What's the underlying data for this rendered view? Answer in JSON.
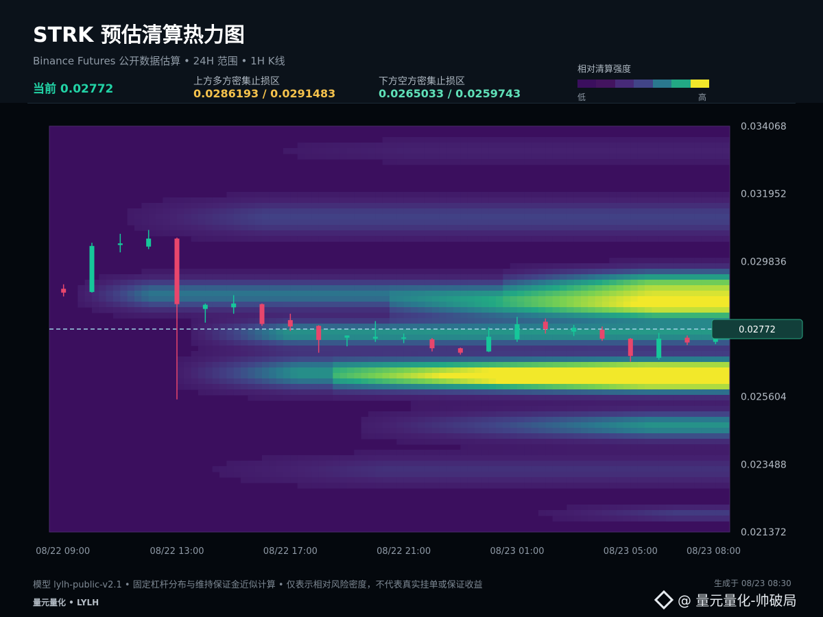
{
  "header": {
    "title": "STRK 预估清算热力图",
    "subtitle": "Binance Futures 公开数据估算 • 24H 范围 • 1H K线",
    "current_price_text": "当前 0.02772",
    "upper_zone_label": "上方多方密集止损区",
    "upper_zone_value": "0.0286193 / 0.0291483",
    "lower_zone_label": "下方空方密集止损区",
    "lower_zone_value": "0.0265033 / 0.0259743"
  },
  "legend": {
    "title": "相对清算强度",
    "low": "低",
    "high": "高",
    "colors": [
      "#3b0f5e",
      "#43145f",
      "#472a78",
      "#414487",
      "#2a788e",
      "#22a884",
      "#f2e82a"
    ]
  },
  "chart_data": {
    "type": "heatmap",
    "overlay": "candlestick",
    "y_ticks": [
      "0.034068",
      "0.031952",
      "0.029836",
      "0.027720",
      "0.025604",
      "0.023488",
      "0.021372"
    ],
    "y_tick_labels": [
      "0.034068",
      "0.031952",
      "0.029836",
      "",
      "0.025604",
      "0.023488",
      "0.021372"
    ],
    "ylim": [
      0.021372,
      0.034068
    ],
    "x_tick_labels": [
      "08/22 09:00",
      "08/22 13:00",
      "08/22 17:00",
      "08/22 21:00",
      "08/23 01:00",
      "08/23 05:00",
      "08/23 08:00"
    ],
    "x_tick_hours": [
      0,
      4,
      8,
      12,
      16,
      20,
      23
    ],
    "current_price": 0.02772,
    "current_price_label": "0.02772",
    "colors": {
      "up": "#16c79a",
      "down": "#e8466c",
      "price_line": "#9fd3e6"
    },
    "candles": [
      {
        "o": 0.02898,
        "h": 0.02912,
        "l": 0.02874,
        "c": 0.02886
      },
      {
        "o": 0.02888,
        "h": 0.03042,
        "l": 0.02886,
        "c": 0.03032
      },
      {
        "o": 0.03035,
        "h": 0.0307,
        "l": 0.03012,
        "c": 0.0304
      },
      {
        "o": 0.0303,
        "h": 0.03082,
        "l": 0.03022,
        "c": 0.03055
      },
      {
        "o": 0.03055,
        "h": 0.03058,
        "l": 0.02552,
        "c": 0.0285
      },
      {
        "o": 0.02835,
        "h": 0.02852,
        "l": 0.02792,
        "c": 0.02848
      },
      {
        "o": 0.0284,
        "h": 0.02878,
        "l": 0.0282,
        "c": 0.02852
      },
      {
        "o": 0.0285,
        "h": 0.02852,
        "l": 0.02782,
        "c": 0.02788
      },
      {
        "o": 0.028,
        "h": 0.0282,
        "l": 0.02766,
        "c": 0.0278
      },
      {
        "o": 0.02782,
        "h": 0.02784,
        "l": 0.02698,
        "c": 0.02738
      },
      {
        "o": 0.02745,
        "h": 0.02752,
        "l": 0.02718,
        "c": 0.02752
      },
      {
        "o": 0.02742,
        "h": 0.02797,
        "l": 0.02732,
        "c": 0.02748
      },
      {
        "o": 0.02744,
        "h": 0.02758,
        "l": 0.02728,
        "c": 0.02746
      },
      {
        "o": 0.0274,
        "h": 0.02744,
        "l": 0.02702,
        "c": 0.02712
      },
      {
        "o": 0.02712,
        "h": 0.02714,
        "l": 0.02692,
        "c": 0.02698
      },
      {
        "o": 0.02702,
        "h": 0.02777,
        "l": 0.027,
        "c": 0.02748
      },
      {
        "o": 0.0274,
        "h": 0.0281,
        "l": 0.02732,
        "c": 0.02787
      },
      {
        "o": 0.02795,
        "h": 0.02805,
        "l": 0.02758,
        "c": 0.02772
      },
      {
        "o": 0.02764,
        "h": 0.02785,
        "l": 0.0275,
        "c": 0.02776
      },
      {
        "o": 0.0277,
        "h": 0.0278,
        "l": 0.02735,
        "c": 0.02742
      },
      {
        "o": 0.02742,
        "h": 0.02744,
        "l": 0.0267,
        "c": 0.02688
      },
      {
        "o": 0.02682,
        "h": 0.0276,
        "l": 0.02676,
        "c": 0.02742
      },
      {
        "o": 0.02745,
        "h": 0.02752,
        "l": 0.02722,
        "c": 0.0273
      },
      {
        "o": 0.02732,
        "h": 0.0277,
        "l": 0.02725,
        "c": 0.02742
      }
    ],
    "heat_bands": [
      {
        "center": 0.02622,
        "width": 0.00042,
        "intensity": 0.95,
        "start": 10.0,
        "grow": 13
      },
      {
        "center": 0.02635,
        "width": 0.00055,
        "intensity": 0.55,
        "start": 4.5,
        "grow": 5
      },
      {
        "center": 0.02838,
        "width": 0.00042,
        "intensity": 0.7,
        "start": 12.0,
        "grow": 11
      },
      {
        "center": 0.02758,
        "width": 0.0004,
        "intensity": 0.55,
        "start": 5.0,
        "grow": 4
      },
      {
        "center": 0.0292,
        "width": 0.00045,
        "intensity": 0.5,
        "start": 16.0,
        "grow": 6
      },
      {
        "center": 0.0288,
        "width": 0.0005,
        "intensity": 0.45,
        "start": 1.0,
        "grow": 3
      },
      {
        "center": 0.0247,
        "width": 0.00045,
        "intensity": 0.55,
        "start": 11.0,
        "grow": 12
      },
      {
        "center": 0.0312,
        "width": 0.0006,
        "intensity": 0.28,
        "start": 2.5,
        "grow": 6
      },
      {
        "center": 0.0233,
        "width": 0.0005,
        "intensity": 0.2,
        "start": 5.0,
        "grow": 8
      },
      {
        "center": 0.02195,
        "width": 0.00025,
        "intensity": 0.25,
        "start": 17.0,
        "grow": 6
      },
      {
        "center": 0.0333,
        "width": 0.0004,
        "intensity": 0.12,
        "start": 6.0,
        "grow": 8
      }
    ]
  },
  "footer": {
    "note": "模型 lylh-public-v2.1 • 固定杠杆分布与维持保证金近似计算 • 仅表示相对风险密度，不代表真实挂单或保证收益",
    "brand": "量元量化 • LYLH",
    "generated": "生成于 08/23 08:30",
    "watermark": "@ 量元量化-帅破局"
  }
}
